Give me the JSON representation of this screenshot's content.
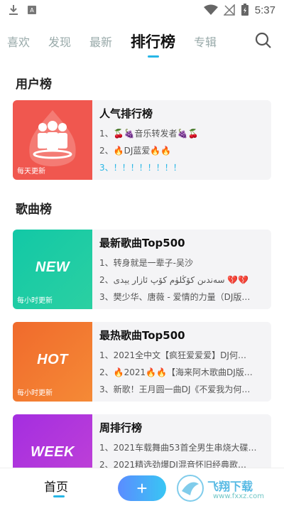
{
  "status": {
    "time": "5:37"
  },
  "tabs": [
    {
      "label": "喜欢"
    },
    {
      "label": "发现"
    },
    {
      "label": "最新"
    },
    {
      "label": "排行榜"
    },
    {
      "label": "专辑"
    }
  ],
  "sections": {
    "user": "用户榜",
    "song": "歌曲榜"
  },
  "cards": [
    {
      "title": "人气排行榜",
      "thumb_caption": "每天更新",
      "thumb_text": "",
      "lines": [
        "1、🍒🍇音乐转发者🍇🍒",
        "2、🔥DJ蓝爱🔥🔥",
        "3、！！！！！！！！"
      ],
      "color": "#f0574f"
    },
    {
      "title": "最新歌曲Top500",
      "thumb_caption": "每小时更新",
      "thumb_text": "NEW",
      "lines": [
        "1、转身就是一辈子-吴沙",
        "2、سەندىن كۆڭلۈم كۆپ ئازار يېدى 💔💔",
        "3、樊少华、唐薇 - 爱情的力量（DJ版…"
      ],
      "color": "#1cc6a6"
    },
    {
      "title": "最热歌曲Top500",
      "thumb_caption": "每小时更新",
      "thumb_text": "HOT",
      "lines": [
        "1、2021全中文【疯狂爱爱爱】DJ何…",
        "2、🔥2021🔥🔥【海来阿木歌曲DJ版…",
        "3、新歌！王月圆一曲DJ《不爱我为何…"
      ],
      "color": "#f37a2e"
    },
    {
      "title": "周排行榜",
      "thumb_caption": "",
      "thumb_text": "WEEK",
      "lines": [
        "1、2021车载舞曲53首全男生串烧大碟…",
        "2、2021精选劲爆DJ混音怀旧经典歌…"
      ],
      "color": "#b638dc"
    }
  ],
  "bottom": {
    "home_label": "首页",
    "plus": "+",
    "watermark": "飞翔下载",
    "watermark_url": "www.fxxz.com"
  },
  "icons": {
    "search": "search-icon",
    "download": "download-icon",
    "wifi": "wifi-icon",
    "battery": "battery-icon"
  }
}
